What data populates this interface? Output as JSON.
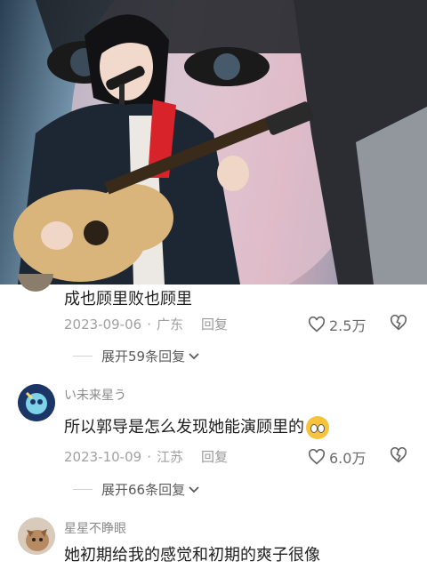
{
  "comments": [
    {
      "text": "成也顾里败也顾里",
      "date": "2023-09-06",
      "location": "广东",
      "reply_label": "回复",
      "likes": "2.5万",
      "expand_label": "展开59条回复"
    },
    {
      "username": "い未来星う",
      "text": "所以郭导是怎么发现她能演顾里的",
      "date": "2023-10-09",
      "location": "江苏",
      "reply_label": "回复",
      "likes": "6.0万",
      "expand_label": "展开66条回复"
    },
    {
      "username": "星星不睁眼",
      "text": "她初期给我的感觉和初期的爽子很像"
    }
  ],
  "colors": {
    "text": "#1f1f1f",
    "meta": "#a0a0a0",
    "username": "#8a8a8a",
    "accent_red": "#d8232a"
  },
  "icons": [
    "heart-icon",
    "broken-heart-icon",
    "chevron-down-icon",
    "crying-emoji-icon"
  ]
}
